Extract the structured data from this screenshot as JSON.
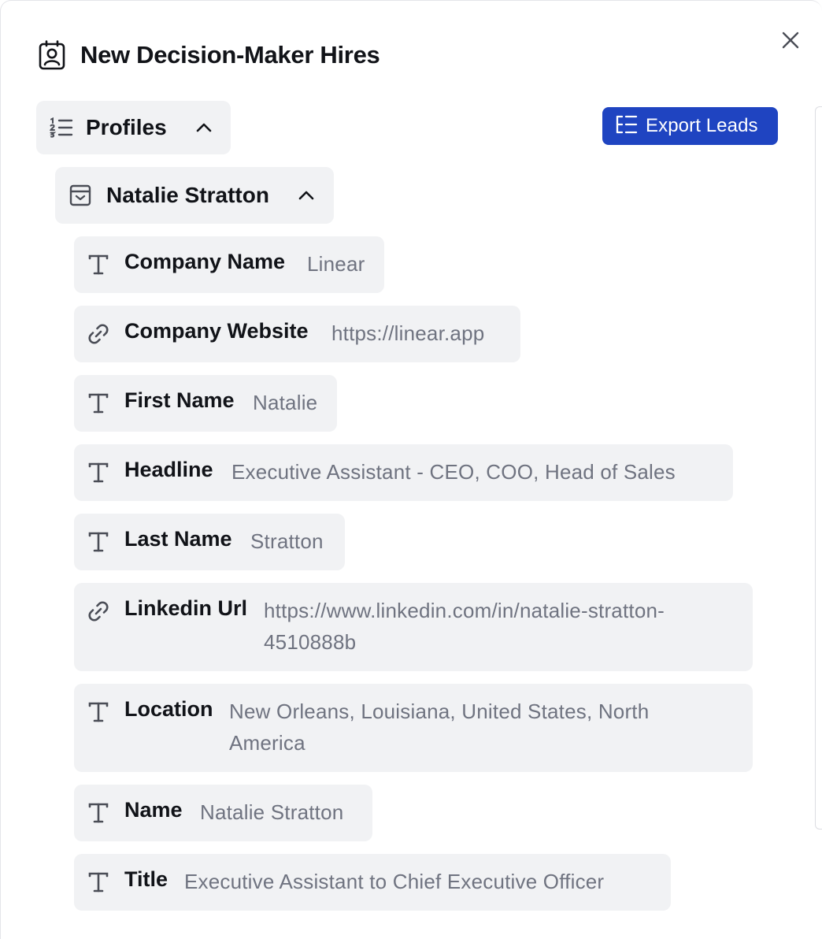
{
  "window": {
    "title": "New Decision-Maker Hires",
    "title_icon": "contact-badge-icon",
    "close_icon": "close-icon"
  },
  "toolbar": {
    "export_label": "Export Leads",
    "export_icon": "list-tree-icon"
  },
  "profiles_group": {
    "label": "Profiles",
    "icon": "ordered-list-icon",
    "expanded": true
  },
  "profile": {
    "label": "Natalie Stratton",
    "icon": "archive-box-icon",
    "expanded": true,
    "fields": [
      {
        "name": "Company Name",
        "value": "Linear",
        "icon": "text-type-icon"
      },
      {
        "name": "Company Website",
        "value": "https://linear.app",
        "icon": "link-icon"
      },
      {
        "name": "First Name",
        "value": "Natalie",
        "icon": "text-type-icon"
      },
      {
        "name": "Headline",
        "value": "Executive Assistant - CEO, COO, Head of Sales",
        "icon": "text-type-icon"
      },
      {
        "name": "Last Name",
        "value": "Stratton",
        "icon": "text-type-icon"
      },
      {
        "name": "Linkedin Url",
        "value": "https://www.linkedin.com/in/natalie-stratton-4510888b",
        "icon": "link-icon"
      },
      {
        "name": "Location",
        "value": "New Orleans, Louisiana, United States, North America",
        "icon": "text-type-icon"
      },
      {
        "name": "Name",
        "value": "Natalie Stratton",
        "icon": "text-type-icon"
      },
      {
        "name": "Title",
        "value": "Executive Assistant to Chief Executive Officer",
        "icon": "text-type-icon"
      }
    ]
  },
  "colors": {
    "accent": "#1f44c1",
    "chip_bg": "#f1f2f4",
    "value_text": "#6f7380"
  }
}
